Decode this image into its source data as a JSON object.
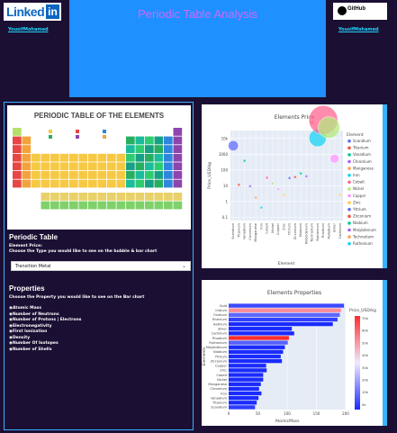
{
  "header": {
    "linkedin_text": "Linked",
    "linkedin_box": "in",
    "linkedin_user": "YousifMohamed",
    "title": "Periodic Table Analysis",
    "github_text": "GitHub",
    "github_user": "YousifMohamed"
  },
  "periodic_image": {
    "title": "PERIODIC TABLE OF THE ELEMENTS"
  },
  "periodic_section": {
    "heading": "Periodic Table",
    "label": "Element Price:",
    "instruction": "Choose the Type you would like to see on the bubble & bar chart",
    "dropdown_value": "Transition Metal",
    "dropdown_arrow": "⌄"
  },
  "properties_section": {
    "heading": "Properties",
    "instruction": "Choose the Property you would like to see on the Bar chart",
    "options": [
      "Atomic Mass",
      "Number of Neutrons",
      "Number of Protons | Electrons",
      "Electronegativity",
      "First Ionization",
      "Density",
      "Number Of Isotopes",
      "Number of Shells"
    ]
  },
  "chart_data": [
    {
      "type": "scatter",
      "title": "Elements Price",
      "xlabel": "Element",
      "ylabel": "Price_USD/kg",
      "legend_title": "Element",
      "legend_position": "right",
      "categories": [
        "Scandium",
        "Titanium",
        "Vanadium",
        "Chromium",
        "Manganese",
        "Iron",
        "Cobalt",
        "Nickel",
        "Copper",
        "Zinc",
        "Yttrium",
        "Zirconium",
        "Niobium",
        "Molybdenum",
        "Technetium",
        "Ruthenium",
        "Rhodium",
        "Palladium",
        "Silver",
        "Cadmium"
      ],
      "y_tick_labels": [
        "10k",
        "1000",
        "100",
        "10",
        "1",
        "0.1"
      ],
      "series": [
        {
          "name": "Scandium",
          "color": "#636efa",
          "values": [
            3460
          ],
          "size": 0.35
        },
        {
          "name": "Titanium",
          "color": "#ef553b",
          "values": [
            11.7
          ],
          "size": 0.1
        },
        {
          "name": "Vanadium",
          "color": "#00cc96",
          "values": [
            385
          ],
          "size": 0.1
        },
        {
          "name": "Chromium",
          "color": "#ab63fa",
          "values": [
            9.4
          ],
          "size": 0.1
        },
        {
          "name": "Manganese",
          "color": "#ffa15a",
          "values": [
            1.8
          ],
          "size": 0.1
        },
        {
          "name": "Iron",
          "color": "#19d3f3",
          "values": [
            0.42
          ],
          "size": 0.1
        },
        {
          "name": "Cobalt",
          "color": "#ff6692",
          "values": [
            32.8
          ],
          "size": 0.1
        },
        {
          "name": "Nickel",
          "color": "#b6e880",
          "values": [
            13.9
          ],
          "size": 0.1
        },
        {
          "name": "Copper",
          "color": "#ff97ff",
          "values": [
            6
          ],
          "size": 0.1
        },
        {
          "name": "Zinc",
          "color": "#fecb52",
          "values": [
            2.6
          ],
          "size": 0.1
        },
        {
          "name": "Yttrium",
          "color": "#636efa",
          "values": [
            31
          ],
          "size": 0.1
        },
        {
          "name": "Zirconium",
          "color": "#ef553b",
          "values": [
            35.7
          ],
          "size": 0.1
        },
        {
          "name": "Niobium",
          "color": "#00cc96",
          "values": [
            61
          ],
          "size": 0.1
        },
        {
          "name": "Molybdenum",
          "color": "#ab63fa",
          "values": [
            40
          ],
          "size": 0.1
        },
        {
          "name": "Technetium",
          "color": "#ffa15a",
          "values": [
            100000
          ],
          "size": 0.15
        },
        {
          "name": "Ruthenium",
          "color": "#19d3f3",
          "values": [
            10600
          ],
          "size": 0.6
        },
        {
          "name": "Rhodium",
          "color": "#ff6692",
          "values": [
            147000
          ],
          "size": 1.0
        },
        {
          "name": "Palladium",
          "color": "#b6e880",
          "values": [
            49500
          ],
          "size": 0.75
        },
        {
          "name": "Silver",
          "color": "#ff97ff",
          "values": [
            521
          ],
          "size": 0.3
        },
        {
          "name": "Cadmium",
          "color": "#fecb52",
          "values": [
            2.73
          ],
          "size": 0.1
        }
      ]
    },
    {
      "type": "bar",
      "orientation": "horizontal",
      "title": "Elements Properties",
      "xlabel": "AtomicMass",
      "ylabel": "Elements",
      "xlim": [
        0,
        200
      ],
      "x_ticks": [
        0,
        50,
        100,
        150,
        200
      ],
      "colorbar_title": "Price_USD/kg",
      "colorbar_ticks": [
        "70k",
        "60k",
        "50k",
        "40k",
        "30k",
        "20k",
        "10k",
        "0k"
      ],
      "categories": [
        "Gold",
        "Iridium",
        "Osmium",
        "Rhenium",
        "Hafnium",
        "Silver",
        "Cadmium",
        "Rhodium",
        "Ruthenium",
        "Molybdenum",
        "Niobium",
        "Yttrium",
        "Zirconium",
        "Copper",
        "Zinc",
        "Cobalt",
        "Nickel",
        "Manganese",
        "Chromium",
        "Iron",
        "Vanadium",
        "Titanium",
        "Scandium"
      ],
      "values": [
        197,
        192,
        190,
        186,
        178,
        108,
        112,
        103,
        101,
        96,
        93,
        89,
        91,
        64,
        65,
        59,
        59,
        55,
        52,
        56,
        51,
        48,
        45
      ],
      "price": [
        6000,
        56000,
        12000,
        4150,
        900,
        521,
        2.7,
        147000,
        10600,
        40,
        61,
        31,
        36,
        6,
        2.6,
        33,
        14,
        1.8,
        9.4,
        0.4,
        385,
        11.7,
        3460
      ]
    }
  ],
  "colors": {
    "background": "#1b0f33",
    "accent": "#1e90ff",
    "title_text": "#c86cff",
    "link": "#21d4fd"
  }
}
